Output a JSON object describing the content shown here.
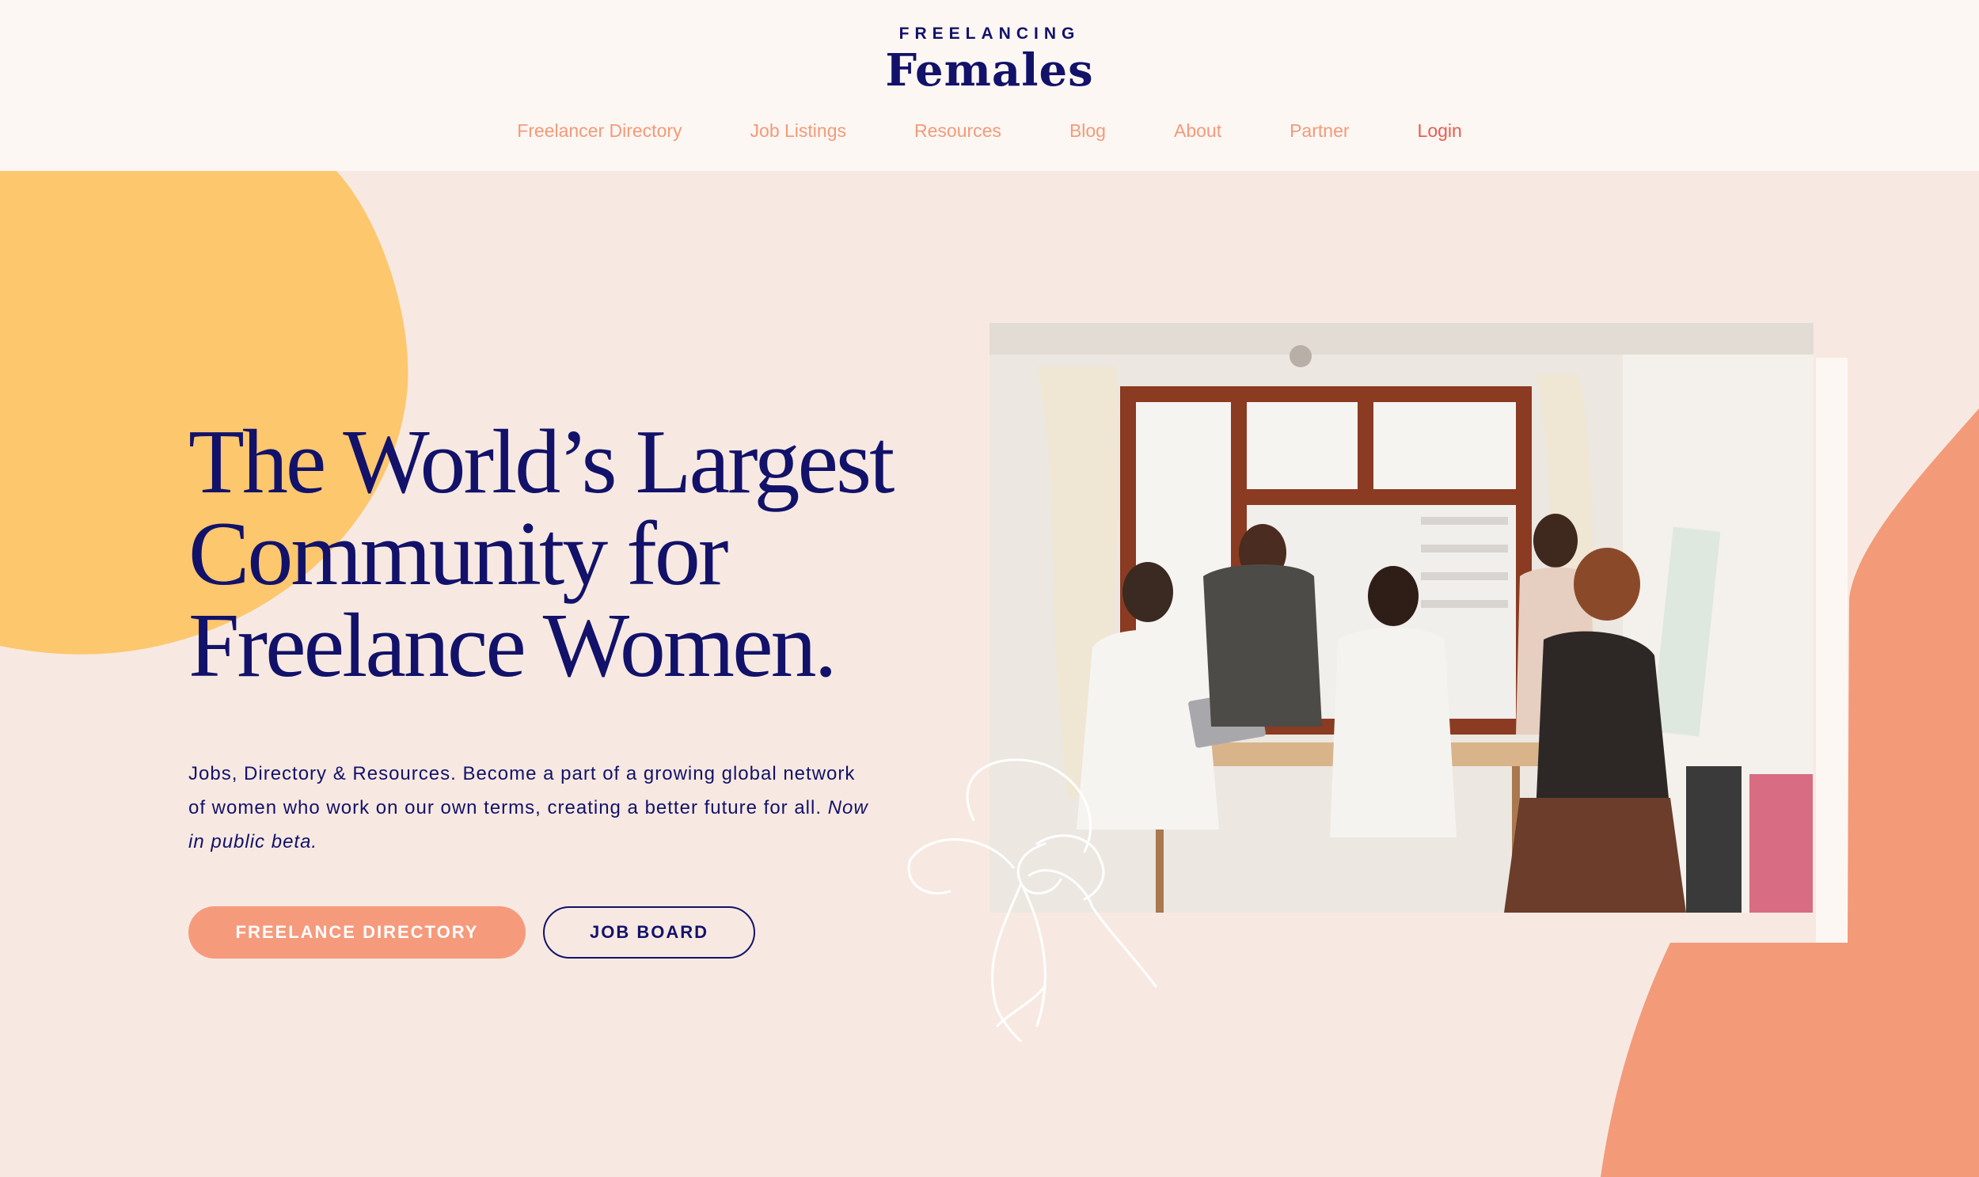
{
  "header": {
    "logo_small": "FREELANCING",
    "logo_main": "Females",
    "nav": [
      {
        "label": "Freelancer Directory"
      },
      {
        "label": "Job Listings"
      },
      {
        "label": "Resources"
      },
      {
        "label": "Blog"
      },
      {
        "label": "About"
      },
      {
        "label": "Partner"
      },
      {
        "label": "Login"
      }
    ]
  },
  "hero": {
    "headline_line1": "The World’s Largest",
    "headline_line2": "Community for",
    "headline_line3": "Freelance Women.",
    "subtext": "Jobs, Directory & Resources. Become a part of a growing global network of women who work on our own terms, creating a better future for all.",
    "subtext_italic": "Now in public beta.",
    "btn_directory": "FREELANCE DIRECTORY",
    "btn_jobs": "JOB BOARD"
  },
  "colors": {
    "navy": "#12126a",
    "coral": "#f39a79",
    "yellow": "#fdc76e",
    "peach_bg": "#f7e9e1",
    "header_bg": "#fdf7f3",
    "login": "#ec5a4e"
  }
}
